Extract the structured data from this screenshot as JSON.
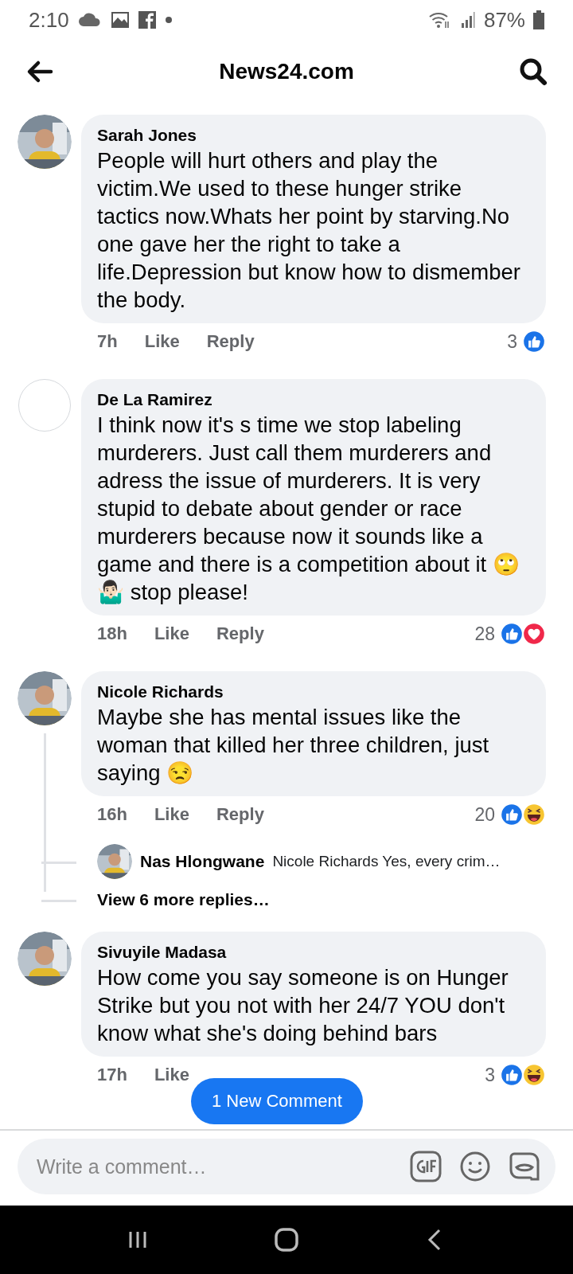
{
  "status_bar": {
    "time": "2:10",
    "battery": "87%"
  },
  "header": {
    "title": "News24.com"
  },
  "comments": [
    {
      "author": "Sarah Jones",
      "avatar": {
        "kind": "picture"
      },
      "text": "People will hurt others and play the victim.We used to these hunger strike tactics now.Whats her point by starving.No one gave her the right to take a life.Depression but know how to dismember the body.",
      "time": "7h",
      "like": "Like",
      "reply": "Reply",
      "count": "3",
      "reactions": [
        {
          "kind": "like"
        }
      ]
    },
    {
      "author": "De La Ramirez",
      "avatar": {
        "kind": "blank"
      },
      "text": "I think now it's s time we stop labeling murderers. Just call them murderers and adress the issue of murderers. It is very stupid to debate about gender or race murderers because now it sounds like a game and there is a competition about it 🙄 🤷🏻‍♂️ stop please!",
      "time": "18h",
      "like": "Like",
      "reply": "Reply",
      "count": "28",
      "reactions": [
        {
          "kind": "like"
        },
        {
          "kind": "love"
        }
      ]
    },
    {
      "author": "Nicole Richards",
      "avatar": {
        "kind": "picture"
      },
      "text": "Maybe she has mental issues like the woman that killed her three children, just saying 😒",
      "time": "16h",
      "like": "Like",
      "reply": "Reply",
      "count": "20",
      "reactions": [
        {
          "kind": "like"
        },
        {
          "kind": "haha"
        }
      ],
      "replies": [
        {
          "author": "Nas Hlongwane",
          "avatar": {
            "kind": "picture"
          },
          "text": "Nicole Richards Yes, every crim…"
        }
      ],
      "more_replies": "View 6 more replies…"
    },
    {
      "author": "Sivuyile Madasa",
      "avatar": {
        "kind": "picture"
      },
      "text": "How come you say someone is on Hunger Strike but you not with her 24/7 YOU don't know what she's doing behind bars",
      "time": "17h",
      "like": "Like",
      "count": "3",
      "reactions": [
        {
          "kind": "like"
        },
        {
          "kind": "haha"
        }
      ]
    }
  ],
  "new_comment_pill": "1 New Comment",
  "composer": {
    "placeholder": "Write a comment…"
  }
}
